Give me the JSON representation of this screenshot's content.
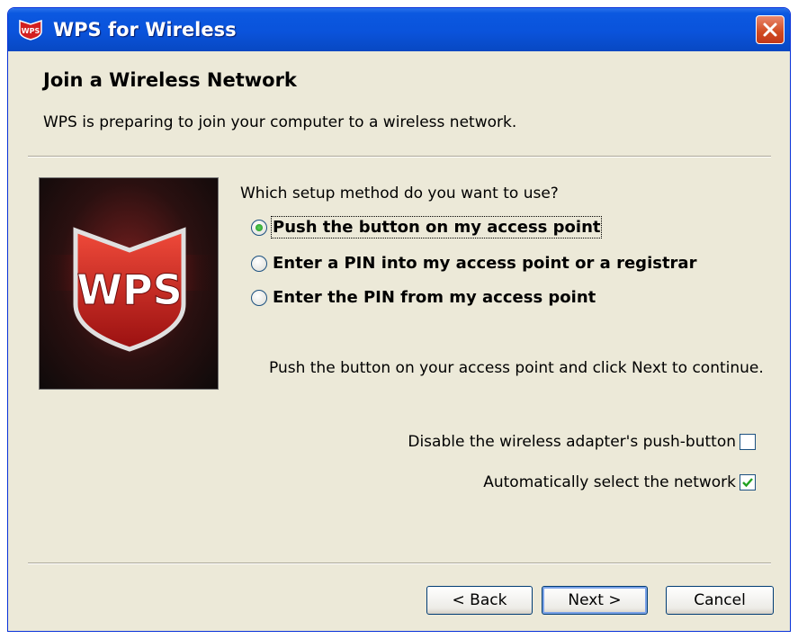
{
  "window": {
    "title": "WPS for Wireless"
  },
  "header": {
    "title": "Join a Wireless Network",
    "subtitle": "WPS is preparing to join your computer to a wireless network."
  },
  "banner": {
    "logo_text": "WPS"
  },
  "setup": {
    "question": "Which setup method do you want to use?",
    "options": [
      {
        "label": "Push the button on my access point",
        "selected": true
      },
      {
        "label": "Enter a PIN into my access point or a registrar",
        "selected": false
      },
      {
        "label": "Enter the PIN from my access point",
        "selected": false
      }
    ],
    "hint": "Push the button on your access point and click Next to continue."
  },
  "options": {
    "disable_pushbutton": {
      "label": "Disable the wireless adapter's push-button",
      "checked": false
    },
    "auto_select": {
      "label": "Automatically select the network",
      "checked": true
    }
  },
  "buttons": {
    "back": "< Back",
    "next": "Next >",
    "cancel": "Cancel"
  },
  "colors": {
    "titlebar": "#0a53db",
    "dialog_bg": "#ece9d8",
    "close": "#d04a20",
    "check": "#21a121"
  }
}
